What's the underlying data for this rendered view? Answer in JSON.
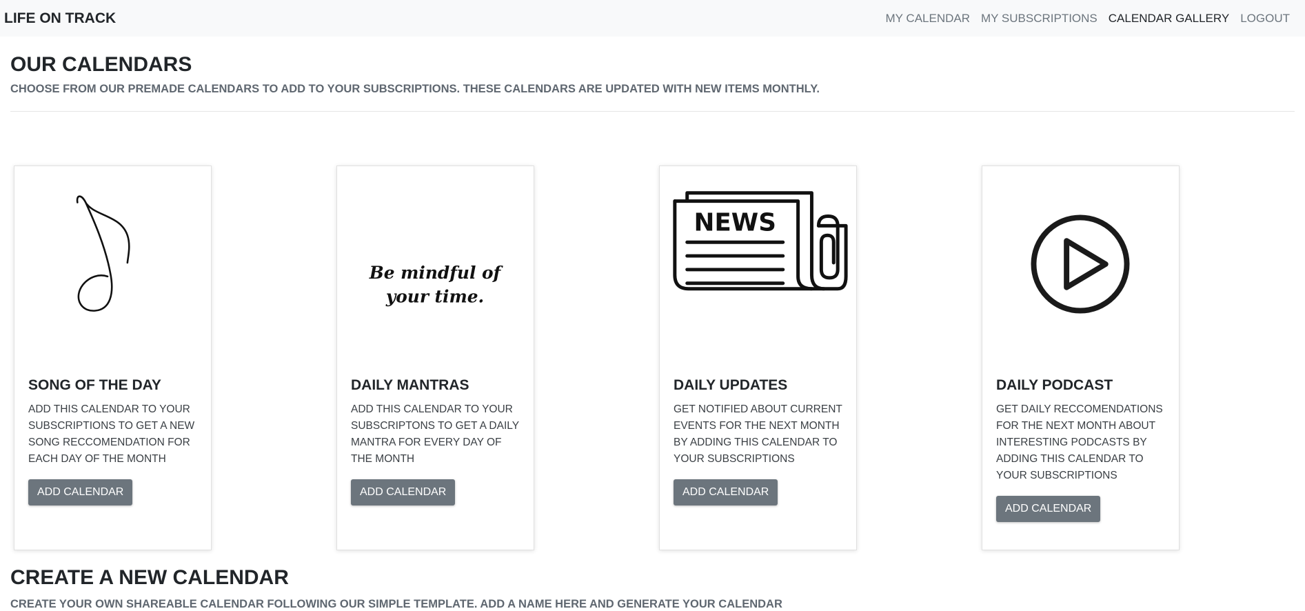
{
  "nav": {
    "brand": "LIFE ON TRACK",
    "links": [
      "MY CALENDAR",
      "MY SUBSCRIPTIONS",
      "CALENDAR GALLERY",
      "LOGOUT"
    ],
    "active": "CALENDAR GALLERY"
  },
  "gallery": {
    "title": "OUR CALENDARS",
    "subtitle": "CHOOSE FROM OUR PREMADE CALENDARS TO ADD TO YOUR SUBSCRIPTIONS. THESE CALENDARS ARE UPDATED WITH NEW ITEMS MONTHLY.",
    "cards": [
      {
        "title": "SONG OF THE DAY",
        "text": "ADD THIS CALENDAR TO YOUR SUBSCRIPTIONS TO GET A NEW SONG RECCOMENDATION FOR EACH DAY OF THE MONTH",
        "button": "ADD CALENDAR",
        "icon": "music-note-icon"
      },
      {
        "title": "DAILY MANTRAS",
        "text": "ADD THIS CALENDAR TO YOUR SUBSCRIPTONS TO GET A DAILY MANTRA FOR EVERY DAY OF THE MONTH",
        "button": "ADD CALENDAR",
        "icon": "mantra-image",
        "image_text": [
          "Be mindful of",
          "your time."
        ]
      },
      {
        "title": "DAILY UPDATES",
        "text": "GET NOTIFIED ABOUT CURRENT EVENTS FOR THE NEXT MONTH BY ADDING THIS CALENDAR TO YOUR SUBSCRIPTIONS",
        "button": "ADD CALENDAR",
        "icon": "newspaper-icon",
        "image_text": "NEWS"
      },
      {
        "title": "DAILY PODCAST",
        "text": "GET DAILY RECCOMENDATIONS FOR THE NEXT MONTH ABOUT INTERESTING PODCASTS BY ADDING THIS CALENDAR TO YOUR SUBSCRIPTIONS",
        "button": "ADD CALENDAR",
        "icon": "play-icon"
      }
    ]
  },
  "create": {
    "title": "CREATE A NEW CALENDAR",
    "subtitle": "CREATE YOUR OWN SHAREABLE CALENDAR FOLLOWING OUR SIMPLE TEMPLATE. ADD A NAME HERE AND GENERATE YOUR CALENDAR"
  }
}
